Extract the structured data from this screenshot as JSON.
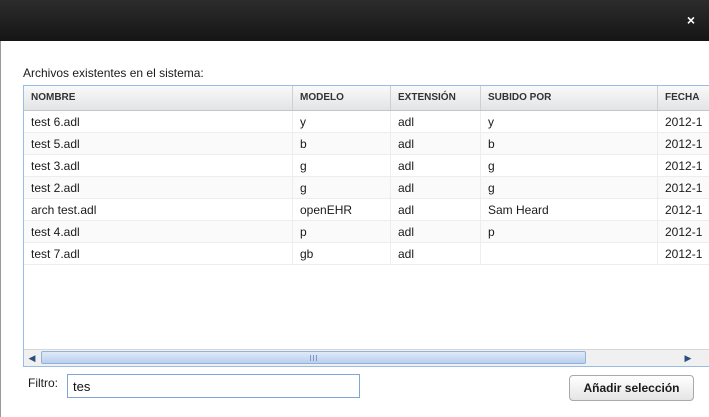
{
  "window": {
    "close_icon_glyph": "×"
  },
  "caption": "Archivos existentes en el sistema:",
  "grid": {
    "columns": [
      "NOMBRE",
      "MODELO",
      "EXTENSIÓN",
      "SUBIDO POR",
      "FECHA"
    ],
    "rows": [
      [
        "test 6.adl",
        "y",
        "adl",
        "y",
        "2012-1"
      ],
      [
        "test 5.adl",
        "b",
        "adl",
        "b",
        "2012-1"
      ],
      [
        "test 3.adl",
        "g",
        "adl",
        "g",
        "2012-1"
      ],
      [
        "test 2.adl",
        "g",
        "adl",
        "g",
        "2012-1"
      ],
      [
        "arch test.adl",
        "openEHR",
        "adl",
        "Sam Heard",
        "2012-1"
      ],
      [
        "test 4.adl",
        "p",
        "adl",
        "p",
        "2012-1"
      ],
      [
        "test 7.adl",
        "gb",
        "adl",
        "",
        "2012-1"
      ]
    ]
  },
  "scrollbar": {
    "left_arrow": "◀",
    "right_arrow": "▶"
  },
  "filter": {
    "label": "Filtro:",
    "value": "tes"
  },
  "actions": {
    "add_selection_label": "Añadir selección"
  },
  "colors": {
    "titlebar": "#1e1e1e",
    "grid_border": "#99bbe8",
    "input_border": "#7ea7d8"
  }
}
